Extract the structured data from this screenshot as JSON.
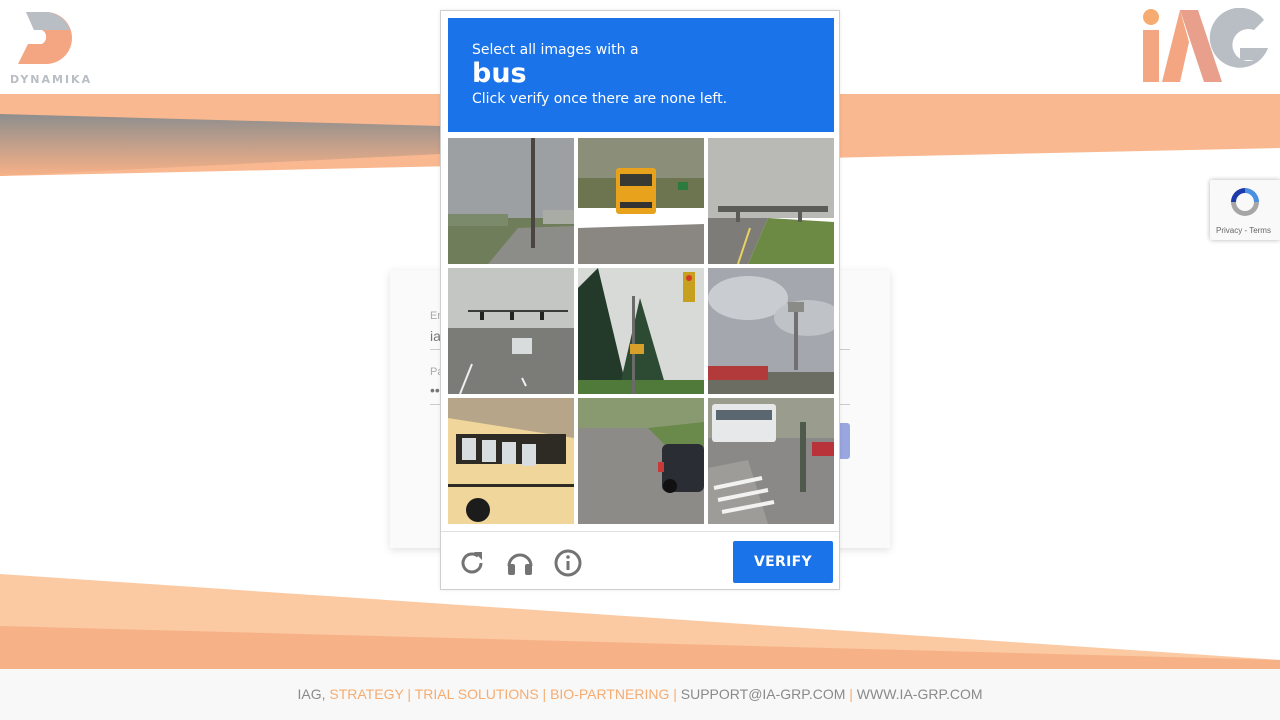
{
  "header": {
    "left_logo": {
      "brand": "DYNAMIKA",
      "letter": "D",
      "icon": "dynamika-logo"
    },
    "right_logo": {
      "text": "iAG",
      "icon": "iag-logo"
    }
  },
  "login_form": {
    "email_label": "Er",
    "email_value": "ia",
    "password_label": "Pa",
    "password_value": "••"
  },
  "captcha": {
    "instruction_line1": "Select all images with a",
    "target": "bus",
    "instruction_line2": "Click verify once there are none left.",
    "tiles": [
      {
        "index": 1,
        "scene": "road-with-utility-pole"
      },
      {
        "index": 2,
        "scene": "school-bus-rear-on-road"
      },
      {
        "index": 3,
        "scene": "highway-overpass"
      },
      {
        "index": 4,
        "scene": "intersection-traffic-lights"
      },
      {
        "index": 5,
        "scene": "pine-trees-traffic-signal"
      },
      {
        "index": 6,
        "scene": "cloudy-sky-gas-station-sign"
      },
      {
        "index": 7,
        "scene": "yellow-school-bus-side"
      },
      {
        "index": 8,
        "scene": "street-with-parked-car"
      },
      {
        "index": 9,
        "scene": "crosswalk-with-white-bus"
      }
    ],
    "footer_icons": [
      "reload-icon",
      "audio-challenge-icon",
      "info-icon"
    ],
    "verify_label": "VERIFY"
  },
  "recaptcha_badge": {
    "terms": "Privacy - Terms"
  },
  "footer": {
    "prefix": "IAG, ",
    "services": "STRATEGY | TRIAL SOLUTIONS | BIO-PARTNERING |",
    "email": " SUPPORT@IA-GRP.COM ",
    "sep": "|",
    "website": " WWW.IA-GRP.COM"
  },
  "colors": {
    "accent_orange": "#f6ac70",
    "captcha_blue": "#1a73e8",
    "gray": "#8a8a8a"
  }
}
